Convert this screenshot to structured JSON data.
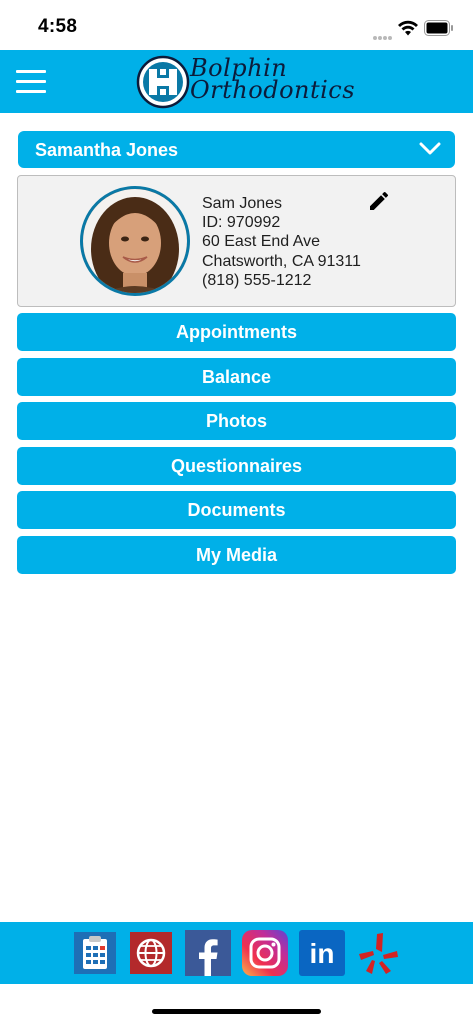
{
  "status_bar": {
    "time": "4:58"
  },
  "header": {
    "logo_line1": "Bolphin",
    "logo_line2": "Orthodontics",
    "brand_color": "#00b0e8"
  },
  "patient_select": {
    "selected": "Samantha Jones"
  },
  "profile": {
    "name": "Sam Jones",
    "id": "ID: 970992",
    "address1": "60 East End Ave",
    "address2": "Chatsworth, CA 91311",
    "phone": "(818) 555-1212"
  },
  "nav": [
    {
      "label": "Appointments"
    },
    {
      "label": "Balance"
    },
    {
      "label": "Photos"
    },
    {
      "label": "Questionnaires"
    },
    {
      "label": "Documents"
    },
    {
      "label": "My Media"
    }
  ],
  "footer": {
    "icons": [
      "clipboard-icon",
      "website-globe-icon",
      "facebook-icon",
      "instagram-icon",
      "linkedin-icon",
      "yelp-icon"
    ],
    "linkedin_text": "in"
  }
}
